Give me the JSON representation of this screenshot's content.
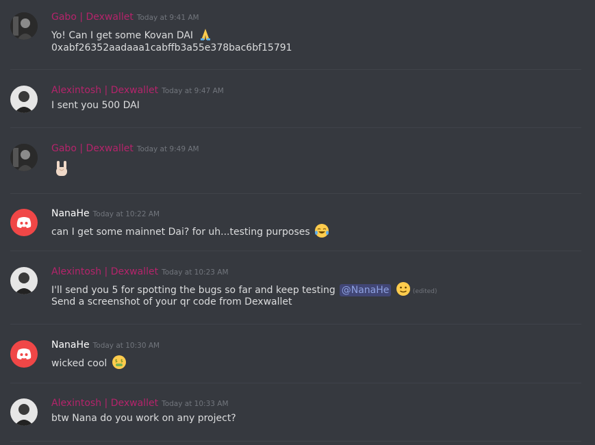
{
  "colors": {
    "background": "#36393f",
    "author_pink": "#b5246b",
    "author_white": "#ffffff",
    "mention_bg": "#414675",
    "mention_fg": "#8ea1e1",
    "timestamp": "#72767d"
  },
  "messages": [
    {
      "author": "Gabo | Dexwallet",
      "timestamp": "Today at 9:41 AM",
      "avatar": "photo-avatar",
      "lines": [
        "Yo! Can I get some Kovan DAI",
        "0xabf26352aadaaa1cabffb3a55e378bac6bf15791"
      ],
      "emoji": "folded-hands-emoji"
    },
    {
      "author": "Alexintosh | Dexwallet",
      "timestamp": "Today at 9:47 AM",
      "avatar": "photo-avatar",
      "lines": [
        "I sent you 500 DAI"
      ]
    },
    {
      "author": "Gabo | Dexwallet",
      "timestamp": "Today at 9:49 AM",
      "avatar": "photo-avatar",
      "emoji": "sign-of-horns-emoji"
    },
    {
      "author": "NanaHe",
      "timestamp": "Today at 10:22 AM",
      "avatar": "discord-avatar",
      "lines": [
        "can  I get some mainnet Dai? for uh...testing purposes"
      ],
      "emoji": "tears-of-joy-emoji"
    },
    {
      "author": "Alexintosh | Dexwallet",
      "timestamp": "Today at 10:23 AM",
      "avatar": "photo-avatar",
      "lines": [
        "I'll send you 5 for spotting the bugs so far and keep testing",
        "Send a screenshot of your qr code from Dexwallet"
      ],
      "mention": "@NanaHe",
      "edited": "(edited)",
      "emoji": "slightly-smiling-emoji"
    },
    {
      "author": "NanaHe",
      "timestamp": "Today at 10:30 AM",
      "avatar": "discord-avatar",
      "lines": [
        "wicked cool"
      ],
      "emoji": "money-mouth-emoji"
    },
    {
      "author": "Alexintosh | Dexwallet",
      "timestamp": "Today at 10:33 AM",
      "avatar": "photo-avatar",
      "lines": [
        "btw Nana do you work on any project?"
      ]
    }
  ]
}
